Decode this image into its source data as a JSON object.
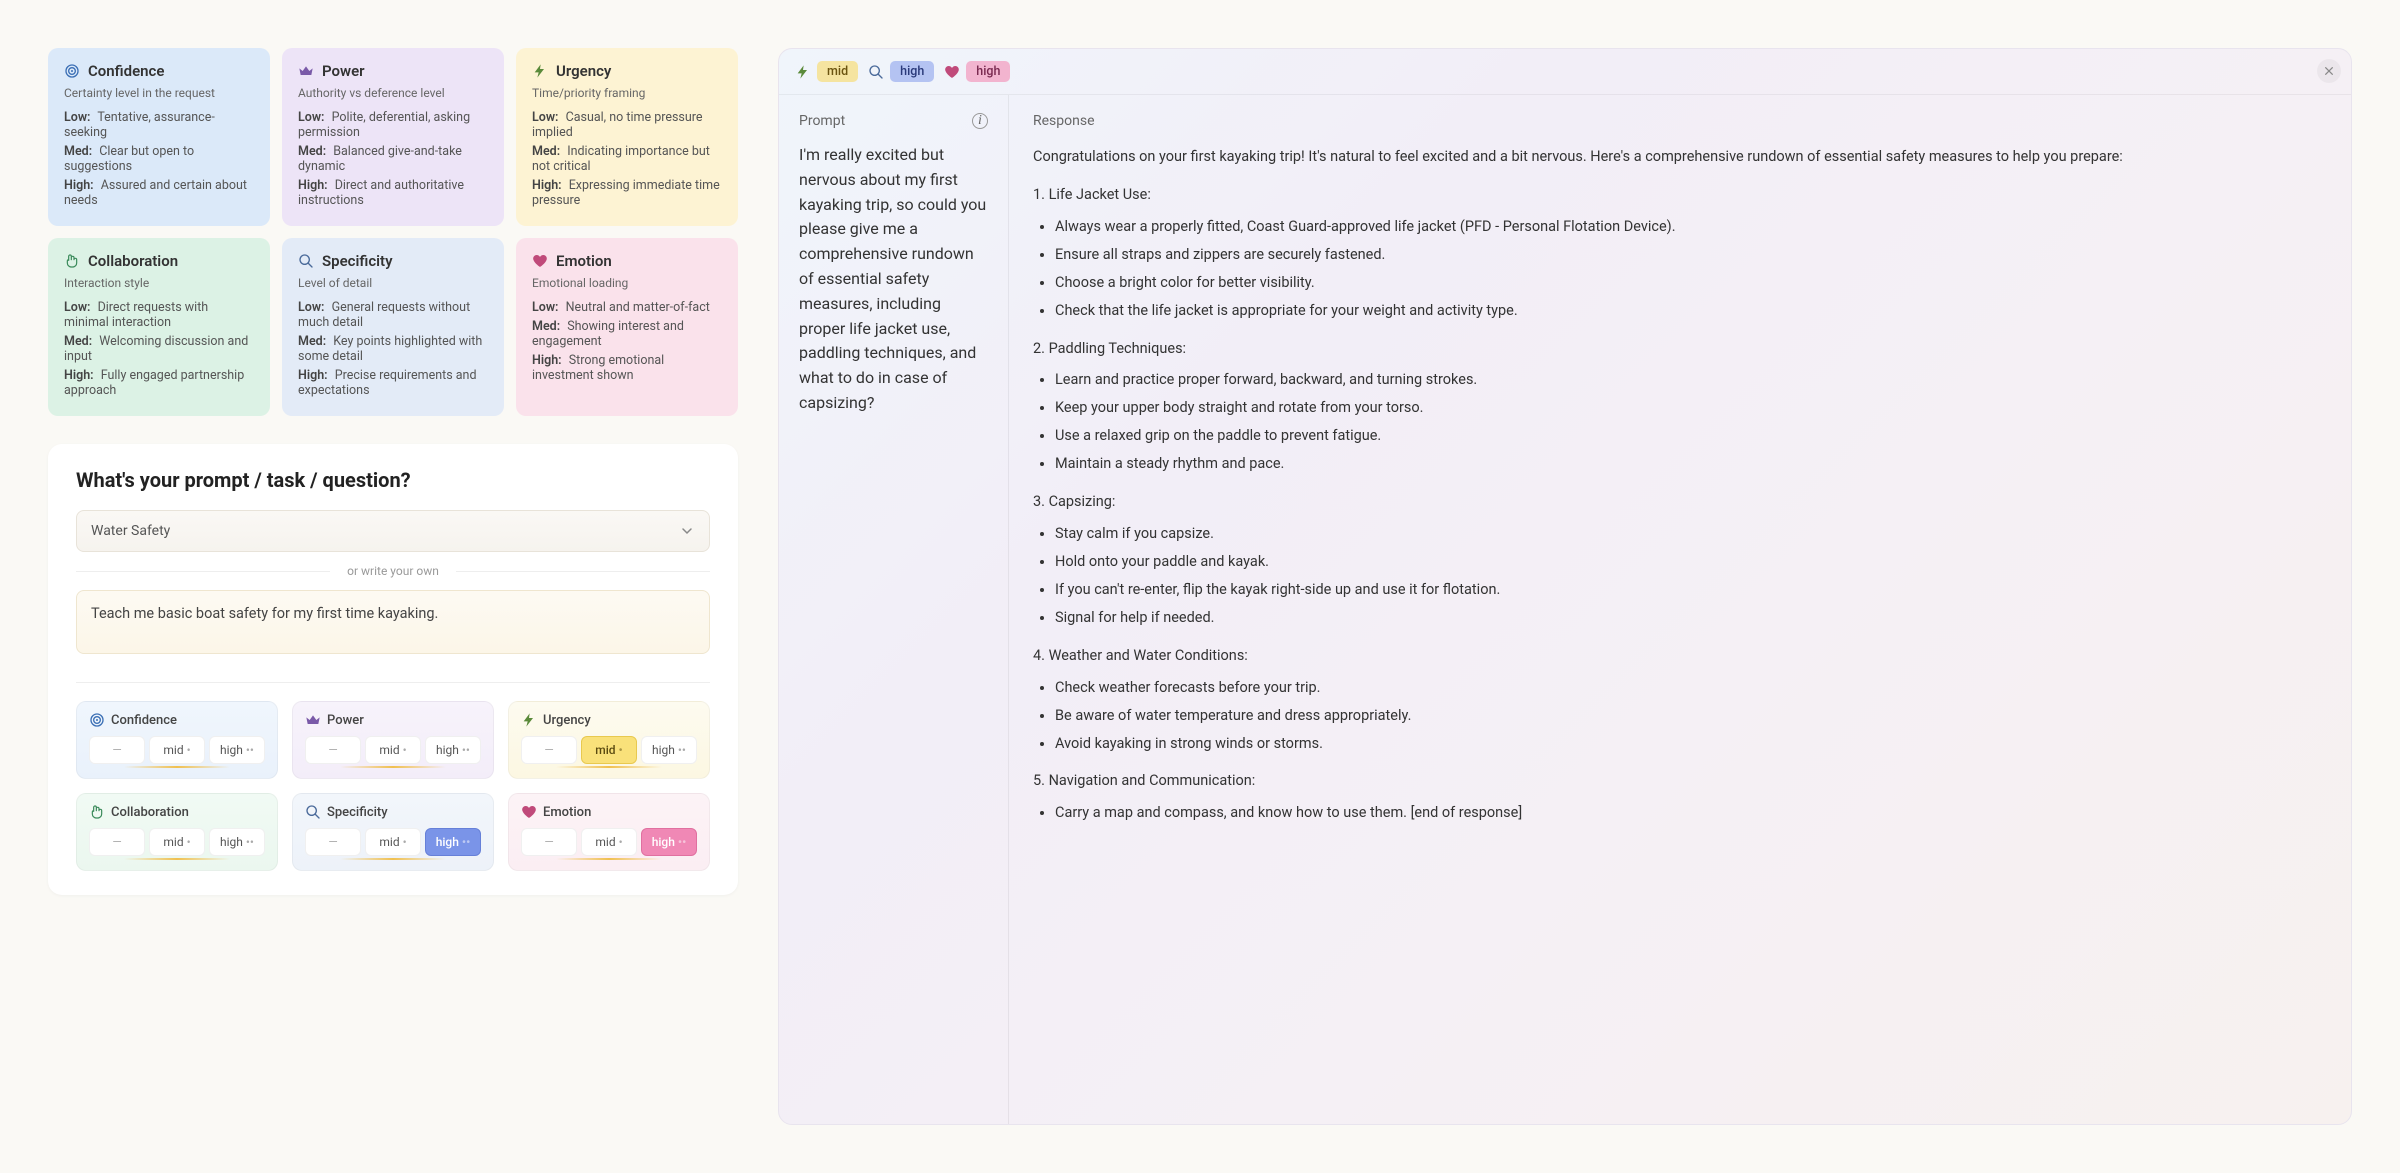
{
  "definitions": [
    {
      "icon": "target",
      "color": "blue",
      "iconColor": "#3b6fb5",
      "title": "Confidence",
      "sub": "Certainty level in the request",
      "low": "Tentative, assurance-seeking",
      "med": "Clear but open to suggestions",
      "high": "Assured and certain about needs"
    },
    {
      "icon": "crown",
      "color": "purple",
      "iconColor": "#7a5aa8",
      "title": "Power",
      "sub": "Authority vs deference level",
      "low": "Polite, deferential, asking permission",
      "med": "Balanced give-and-take dynamic",
      "high": "Direct and authoritative instructions"
    },
    {
      "icon": "bolt",
      "color": "yellow",
      "iconColor": "#5a8a3a",
      "title": "Urgency",
      "sub": "Time/priority framing",
      "low": "Casual, no time pressure implied",
      "med": "Indicating importance but not critical",
      "high": "Expressing immediate time pressure"
    },
    {
      "icon": "hands",
      "color": "green",
      "iconColor": "#3a8a5a",
      "title": "Collaboration",
      "sub": "Interaction style",
      "low": "Direct requests with minimal interaction",
      "med": "Welcoming discussion and input",
      "high": "Fully engaged partnership approach"
    },
    {
      "icon": "search",
      "color": "lblue",
      "iconColor": "#4a6a9a",
      "title": "Specificity",
      "sub": "Level of detail",
      "low": "General requests without much detail",
      "med": "Key points highlighted with some detail",
      "high": "Precise requirements and expectations"
    },
    {
      "icon": "heart",
      "color": "pink",
      "iconColor": "#c04a7a",
      "title": "Emotion",
      "sub": "Emotional loading",
      "low": "Neutral and matter-of-fact",
      "med": "Showing interest and engagement",
      "high": "Strong emotional investment shown"
    }
  ],
  "labels": {
    "low": "Low:",
    "med": "Med:",
    "high": "High:"
  },
  "promptSection": {
    "title": "What's your prompt / task / question?",
    "selectValue": "Water Safety",
    "orText": "or write your own",
    "textValue": "Teach me basic boat safety for my first time kayaking."
  },
  "controlLabels": {
    "dash": "—",
    "mid": "mid",
    "high": "high",
    "dots1": "•",
    "dots2": "••"
  },
  "controls": [
    {
      "icon": "target",
      "color": "blue",
      "iconColor": "#3b6fb5",
      "title": "Confidence",
      "selected": null
    },
    {
      "icon": "crown",
      "color": "purple",
      "iconColor": "#7a5aa8",
      "title": "Power",
      "selected": null
    },
    {
      "icon": "bolt",
      "color": "yellow",
      "iconColor": "#5a8a3a",
      "title": "Urgency",
      "selected": "mid",
      "selClass": "sel-yellow"
    },
    {
      "icon": "hands",
      "color": "green",
      "iconColor": "#3a8a5a",
      "title": "Collaboration",
      "selected": null
    },
    {
      "icon": "search",
      "color": "lblue",
      "iconColor": "#4a6a9a",
      "title": "Specificity",
      "selected": "high",
      "selClass": "sel-blue"
    },
    {
      "icon": "heart",
      "color": "pink",
      "iconColor": "#c04a7a",
      "title": "Emotion",
      "selected": "high",
      "selClass": "sel-pink"
    }
  ],
  "result": {
    "badges": [
      {
        "icon": "bolt",
        "iconColor": "#5a8a3a",
        "value": "mid",
        "pillClass": "yellow"
      },
      {
        "icon": "search",
        "iconColor": "#4a6a9a",
        "value": "high",
        "pillClass": "blue"
      },
      {
        "icon": "heart",
        "iconColor": "#c04a7a",
        "value": "high",
        "pillClass": "pink"
      }
    ],
    "promptLabel": "Prompt",
    "promptText": "I'm really excited but nervous about my first kayaking trip, so could you please give me a comprehensive rundown of essential safety measures, including proper life jacket use, paddling techniques, and what to do in case of capsizing?",
    "responseLabel": "Response",
    "responseIntro": "Congratulations on your first kayaking trip! It's natural to feel excited and a bit nervous. Here's a comprehensive rundown of essential safety measures to help you prepare:",
    "sections": [
      {
        "title": "1. Life Jacket Use:",
        "items": [
          "Always wear a properly fitted, Coast Guard-approved life jacket (PFD - Personal Flotation Device).",
          "Ensure all straps and zippers are securely fastened.",
          "Choose a bright color for better visibility.",
          "Check that the life jacket is appropriate for your weight and activity type."
        ]
      },
      {
        "title": "2. Paddling Techniques:",
        "items": [
          "Learn and practice proper forward, backward, and turning strokes.",
          "Keep your upper body straight and rotate from your torso.",
          "Use a relaxed grip on the paddle to prevent fatigue.",
          "Maintain a steady rhythm and pace."
        ]
      },
      {
        "title": "3. Capsizing:",
        "items": [
          "Stay calm if you capsize.",
          "Hold onto your paddle and kayak.",
          "If you can't re-enter, flip the kayak right-side up and use it for flotation.",
          "Signal for help if needed."
        ]
      },
      {
        "title": "4. Weather and Water Conditions:",
        "items": [
          "Check weather forecasts before your trip.",
          "Be aware of water temperature and dress appropriately.",
          "Avoid kayaking in strong winds or storms."
        ]
      },
      {
        "title": "5. Navigation and Communication:",
        "items": [
          "Carry a map and compass, and know how to use them. [end of response]"
        ]
      }
    ]
  }
}
